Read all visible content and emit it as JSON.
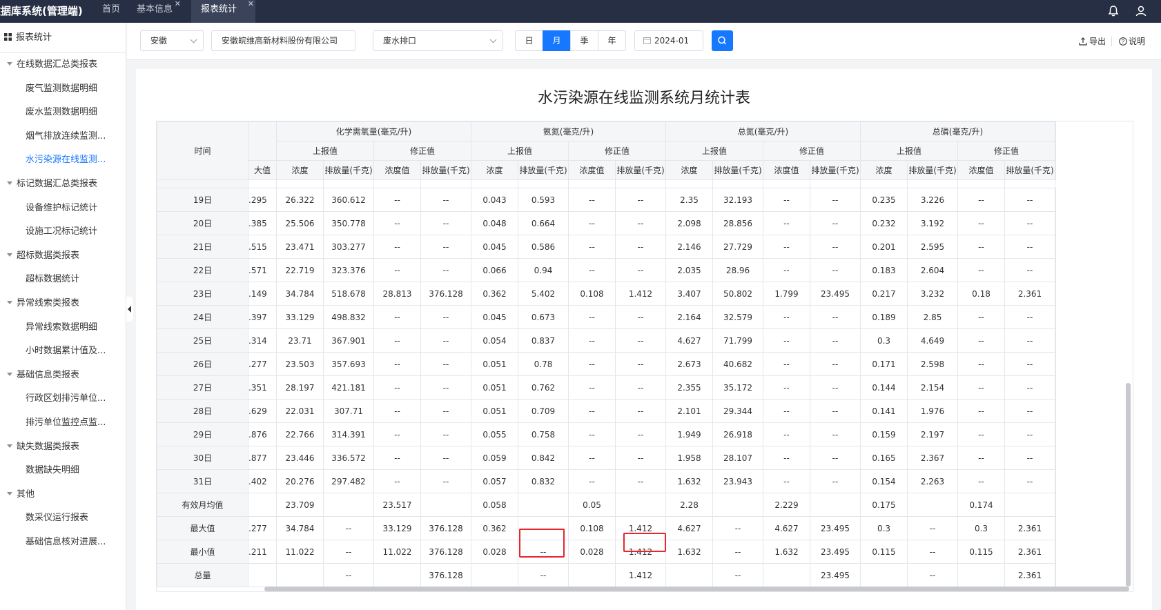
{
  "app": {
    "title": "数据库系统(管理端)",
    "tabs": [
      {
        "label": "首页",
        "closable": false,
        "active": false
      },
      {
        "label": "基本信息",
        "closable": true,
        "active": false
      },
      {
        "label": "报表统计",
        "closable": true,
        "active": true
      }
    ],
    "header_icons": [
      "bell-icon",
      "user-icon"
    ]
  },
  "sidebar": {
    "header": "报表统计",
    "groups": [
      {
        "label": "在线数据汇总类报表",
        "items": [
          "废气监测数据明细",
          "废水监测数据明细",
          "烟气排放连续监测...",
          "水污染源在线监测..."
        ]
      },
      {
        "label": "标记数据汇总类报表",
        "items": [
          "设备维护标记统计",
          "设施工况标记统计"
        ]
      },
      {
        "label": "超标数据类报表",
        "items": [
          "超标数据统计"
        ]
      },
      {
        "label": "异常线索类报表",
        "items": [
          "异常线索数据明细",
          "小时数据累计值及..."
        ]
      },
      {
        "label": "基础信息类报表",
        "items": [
          "行政区划排污单位...",
          "排污单位监控点监..."
        ]
      },
      {
        "label": "缺失数据类报表",
        "items": [
          "数据缺失明细"
        ]
      },
      {
        "label": "其他",
        "items": [
          "数采仪运行报表",
          "基础信息核对进展..."
        ]
      }
    ],
    "active_item": "水污染源在线监测..."
  },
  "toolbar": {
    "province": "安徽",
    "company": "安徽皖维高新材料股份有限公司",
    "outlet": "废水排口",
    "period_buttons": [
      "日",
      "月",
      "季",
      "年"
    ],
    "period_selected": "月",
    "date": "2024-01",
    "export_label": "导出",
    "help_label": "说明"
  },
  "report": {
    "title": "水污染源在线监测系统月统计表",
    "headers": {
      "time": "时间",
      "groups": [
        "化学需氧量(毫克/升)",
        "氨氮(毫克/升)",
        "总氮(毫克/升)",
        "总磷(毫克/升)"
      ],
      "sub_groups": [
        "上报值",
        "修正值"
      ],
      "leaf": [
        "浓度",
        "排放量(千克)",
        "浓度值",
        "排放量(千克)"
      ],
      "partial_left": "大值"
    },
    "rows": [
      {
        "time": "19日",
        "c0": ".295",
        "v": [
          "26.322",
          "360.612",
          "--",
          "--",
          "0.043",
          "0.593",
          "--",
          "--",
          "2.35",
          "32.193",
          "--",
          "--",
          "0.235",
          "3.226",
          "--",
          "--"
        ]
      },
      {
        "time": "20日",
        "c0": ".385",
        "v": [
          "25.506",
          "350.778",
          "--",
          "--",
          "0.048",
          "0.664",
          "--",
          "--",
          "2.098",
          "28.856",
          "--",
          "--",
          "0.232",
          "3.192",
          "--",
          "--"
        ]
      },
      {
        "time": "21日",
        "c0": ".515",
        "v": [
          "23.471",
          "303.277",
          "--",
          "--",
          "0.045",
          "0.586",
          "--",
          "--",
          "2.146",
          "27.729",
          "--",
          "--",
          "0.201",
          "2.595",
          "--",
          "--"
        ]
      },
      {
        "time": "22日",
        "c0": ".571",
        "v": [
          "22.719",
          "323.376",
          "--",
          "--",
          "0.066",
          "0.94",
          "--",
          "--",
          "2.035",
          "28.96",
          "--",
          "--",
          "0.183",
          "2.604",
          "--",
          "--"
        ]
      },
      {
        "time": "23日",
        "c0": ".149",
        "v": [
          "34.784",
          "518.678",
          "28.813",
          "376.128",
          "0.362",
          "5.402",
          "0.108",
          "1.412",
          "3.407",
          "50.802",
          "1.799",
          "23.495",
          "0.217",
          "3.232",
          "0.18",
          "2.361"
        ]
      },
      {
        "time": "24日",
        "c0": ".397",
        "v": [
          "33.129",
          "498.832",
          "--",
          "--",
          "0.045",
          "0.673",
          "--",
          "--",
          "2.164",
          "32.579",
          "--",
          "--",
          "0.189",
          "2.85",
          "--",
          "--"
        ]
      },
      {
        "time": "25日",
        "c0": ".314",
        "v": [
          "23.71",
          "367.901",
          "--",
          "--",
          "0.054",
          "0.837",
          "--",
          "--",
          "4.627",
          "71.799",
          "--",
          "--",
          "0.3",
          "4.649",
          "--",
          "--"
        ]
      },
      {
        "time": "26日",
        "c0": ".277",
        "v": [
          "23.503",
          "357.693",
          "--",
          "--",
          "0.051",
          "0.78",
          "--",
          "--",
          "2.673",
          "40.682",
          "--",
          "--",
          "0.171",
          "2.598",
          "--",
          "--"
        ]
      },
      {
        "time": "27日",
        "c0": ".351",
        "v": [
          "28.197",
          "421.181",
          "--",
          "--",
          "0.051",
          "0.762",
          "--",
          "--",
          "2.355",
          "35.172",
          "--",
          "--",
          "0.144",
          "2.154",
          "--",
          "--"
        ]
      },
      {
        "time": "28日",
        "c0": ".629",
        "v": [
          "22.031",
          "307.71",
          "--",
          "--",
          "0.051",
          "0.709",
          "--",
          "--",
          "2.101",
          "29.344",
          "--",
          "--",
          "0.141",
          "1.976",
          "--",
          "--"
        ]
      },
      {
        "time": "29日",
        "c0": ".876",
        "v": [
          "22.766",
          "314.391",
          "--",
          "--",
          "0.055",
          "0.758",
          "--",
          "--",
          "1.949",
          "26.918",
          "--",
          "--",
          "0.159",
          "2.197",
          "--",
          "--"
        ]
      },
      {
        "time": "30日",
        "c0": ".877",
        "v": [
          "23.446",
          "336.572",
          "--",
          "--",
          "0.059",
          "0.842",
          "--",
          "--",
          "1.958",
          "28.107",
          "--",
          "--",
          "0.165",
          "2.367",
          "--",
          "--"
        ]
      },
      {
        "time": "31日",
        "c0": ".402",
        "v": [
          "20.276",
          "297.482",
          "--",
          "--",
          "0.057",
          "0.832",
          "--",
          "--",
          "1.632",
          "23.943",
          "--",
          "--",
          "0.154",
          "2.263",
          "--",
          "--"
        ]
      },
      {
        "time": "有效月均值",
        "c0": "",
        "v": [
          "23.709",
          "",
          "23.517",
          "",
          "0.058",
          "",
          "0.05",
          "",
          "2.28",
          "",
          "2.229",
          "",
          "0.175",
          "",
          "0.174",
          ""
        ]
      },
      {
        "time": "最大值",
        "c0": ".277",
        "v": [
          "34.784",
          "--",
          "33.129",
          "376.128",
          "0.362",
          "--",
          "0.108",
          "1.412",
          "4.627",
          "--",
          "4.627",
          "23.495",
          "0.3",
          "--",
          "0.3",
          "2.361"
        ]
      },
      {
        "time": "最小值",
        "c0": ".211",
        "v": [
          "11.022",
          "--",
          "11.022",
          "376.128",
          "0.028",
          "--",
          "0.028",
          "1.412",
          "1.632",
          "--",
          "1.632",
          "23.495",
          "0.115",
          "--",
          "0.115",
          "2.361"
        ]
      },
      {
        "time": "总量",
        "c0": "",
        "v": [
          "",
          "--",
          "",
          "376.128",
          "",
          "--",
          "",
          "1.412",
          "",
          "--",
          "",
          "23.495",
          "",
          "--",
          "",
          "2.361"
        ]
      }
    ]
  },
  "colors": {
    "accent": "#1677ff",
    "topbar": "#272f45",
    "highlight": "#e8252b"
  }
}
